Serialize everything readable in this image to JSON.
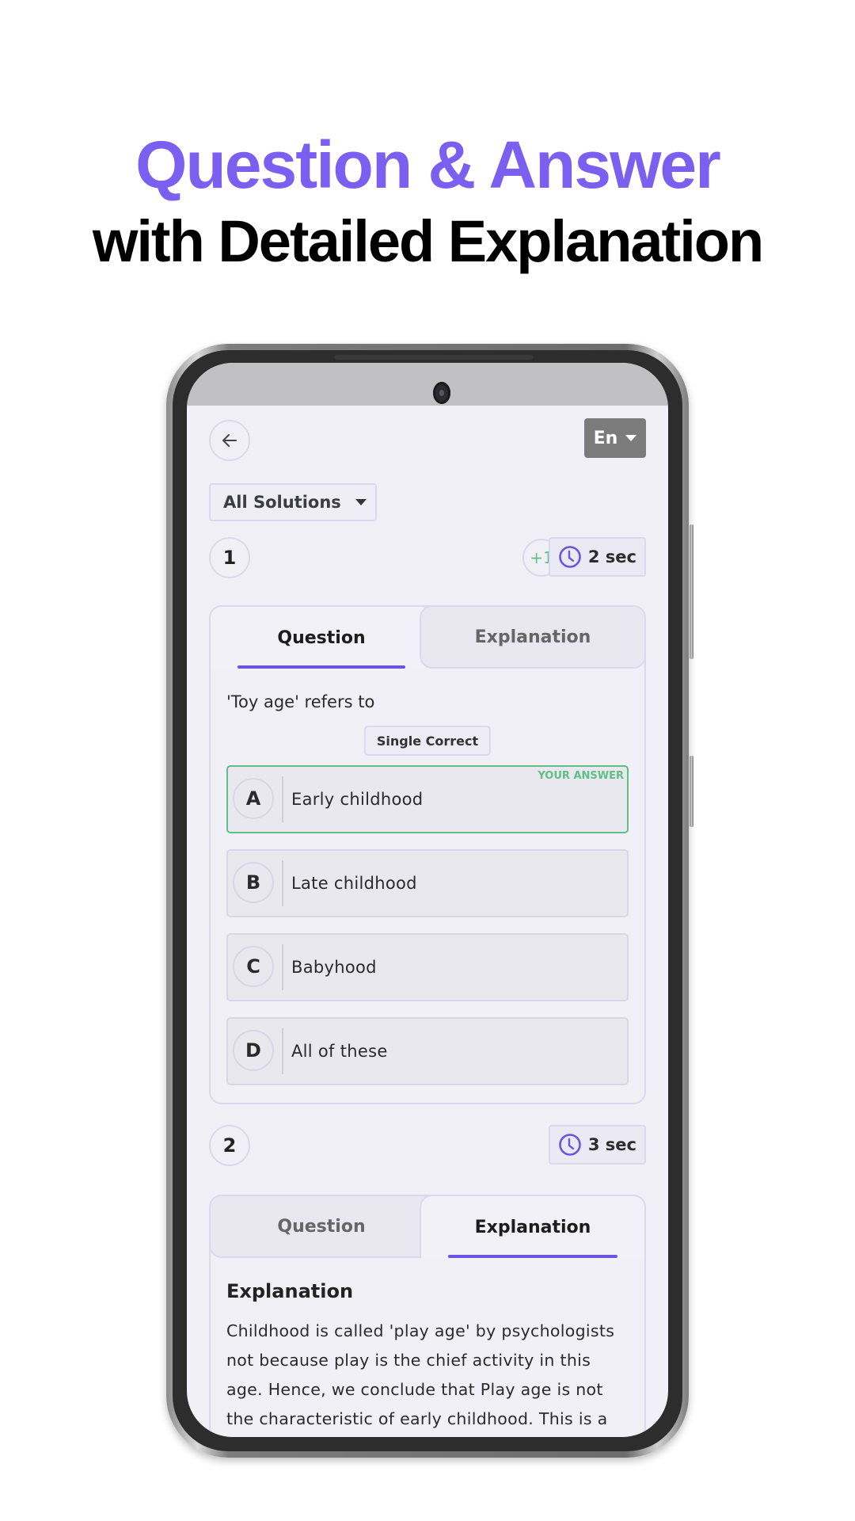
{
  "headline": {
    "line1": "Question & Answer",
    "line2": "with Detailed Explanation"
  },
  "colors": {
    "accent": "#7a5ff0",
    "tab_underline": "#6b55e0",
    "correct_green": "#5fbf85",
    "language_button": "#7b7b7b"
  },
  "app": {
    "back_icon": "arrow-left-icon",
    "language": {
      "label": "En",
      "icon": "caret-down-icon"
    },
    "filter": {
      "label": "All Solutions",
      "icon": "caret-down-icon"
    },
    "questions": [
      {
        "number": "1",
        "score": "+1",
        "time": "2 sec",
        "time_icon": "clock-icon",
        "tabs": [
          {
            "label": "Question",
            "active": true
          },
          {
            "label": "Explanation",
            "active": false
          }
        ],
        "question_text": "'Toy age' refers to",
        "type_badge": "Single Correct",
        "options": [
          {
            "letter": "A",
            "text": "Early childhood",
            "tag": "YOUR ANSWER",
            "selected": true
          },
          {
            "letter": "B",
            "text": "Late childhood"
          },
          {
            "letter": "C",
            "text": "Babyhood"
          },
          {
            "letter": "D",
            "text": "All of these"
          }
        ]
      },
      {
        "number": "2",
        "time": "3 sec",
        "time_icon": "clock-icon",
        "tabs": [
          {
            "label": "Question",
            "active": false
          },
          {
            "label": "Explanation",
            "active": true
          }
        ],
        "explanation_title": "Explanation",
        "explanation_lines": [
          "Childhood is called 'play age' by psychologists",
          "not because play is the chief activity in this",
          "age. Hence, we conclude that Play age is not",
          "the characteristic of early childhood. This is a"
        ]
      }
    ]
  }
}
